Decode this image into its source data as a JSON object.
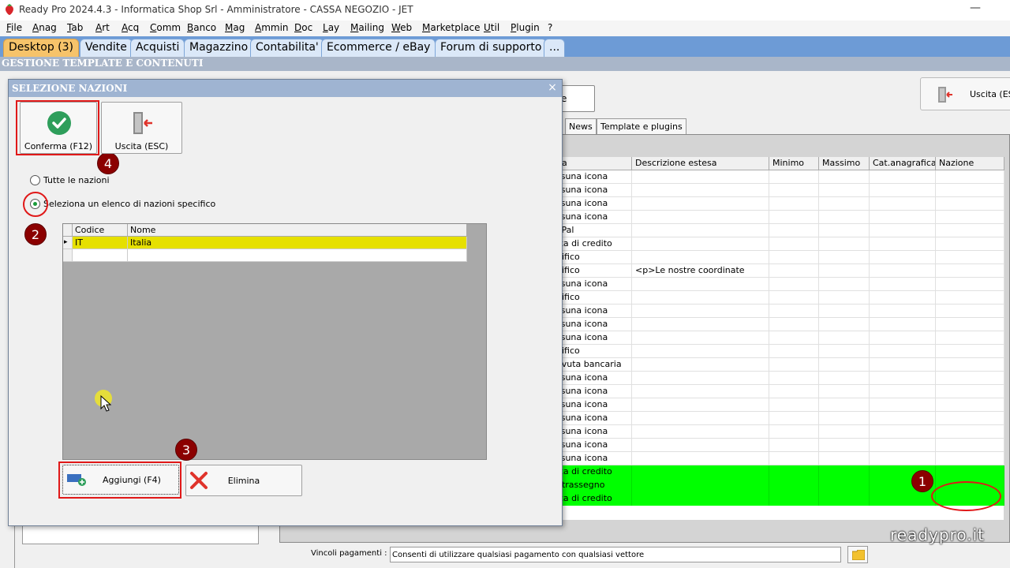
{
  "app": {
    "title": "Ready Pro 2024.4.3 - Informatica Shop Srl - Amministratore - CASSA NEGOZIO - JET",
    "minimize_glyph": "—"
  },
  "menu": [
    "File",
    "Anag",
    "Tab",
    "Art",
    "Acq",
    "Comm",
    "Banco",
    "Mag",
    "Ammin",
    "Doc",
    "Lay",
    "Mailing",
    "Web",
    "Marketplace",
    "Util",
    "Plugin",
    "?"
  ],
  "module_tabs": [
    "Desktop (3)",
    "Vendite",
    "Acquisti",
    "Magazzino",
    "Contabilita'",
    "Ecommerce / eBay",
    "Forum di supporto",
    "..."
  ],
  "section_header": "GESTIONE TEMPLATE E CONTENUTI",
  "background": {
    "exit_button": "Uscita (ESC",
    "partial_button": "e",
    "subtabs": [
      "News",
      "Template e plugins"
    ],
    "grid": {
      "headers": [
        "na",
        "Descrizione estesa",
        "Minimo",
        "Massimo",
        "Cat.anagrafica",
        "Nazione"
      ],
      "rows": [
        {
          "c0": "ssuna icona",
          "c1": "",
          "green": false
        },
        {
          "c0": "ssuna icona",
          "c1": "",
          "green": false
        },
        {
          "c0": "ssuna icona",
          "c1": "",
          "green": false
        },
        {
          "c0": "ssuna icona",
          "c1": "",
          "green": false
        },
        {
          "c0": "yPal",
          "c1": "",
          "green": false
        },
        {
          "c0": "rta di credito",
          "c1": "",
          "green": false
        },
        {
          "c0": "nifico",
          "c1": "",
          "green": false
        },
        {
          "c0": "nifico",
          "c1": "<p>Le nostre coordinate",
          "green": false
        },
        {
          "c0": "ssuna icona",
          "c1": "",
          "green": false
        },
        {
          "c0": "nifico",
          "c1": "",
          "green": false
        },
        {
          "c0": "ssuna icona",
          "c1": "",
          "green": false
        },
        {
          "c0": "ssuna icona",
          "c1": "",
          "green": false
        },
        {
          "c0": "ssuna icona",
          "c1": "",
          "green": false
        },
        {
          "c0": "nifico",
          "c1": "",
          "green": false
        },
        {
          "c0": "evuta bancaria",
          "c1": "",
          "green": false
        },
        {
          "c0": "ssuna icona",
          "c1": "",
          "green": false
        },
        {
          "c0": "ssuna icona",
          "c1": "",
          "green": false
        },
        {
          "c0": "ssuna icona",
          "c1": "",
          "green": false
        },
        {
          "c0": "ssuna icona",
          "c1": "",
          "green": false
        },
        {
          "c0": "ssuna icona",
          "c1": "",
          "green": false
        },
        {
          "c0": "ssuna icona",
          "c1": "",
          "green": false
        },
        {
          "c0": "ssuna icona",
          "c1": "",
          "green": false
        },
        {
          "c0": "rta di credito",
          "c1": "",
          "green": true
        },
        {
          "c0": "ntrassegno",
          "c1": "",
          "green": true
        },
        {
          "c0": "rta di credito",
          "c1": "",
          "green": true
        }
      ]
    },
    "vincoli_label": "Vincoli pagamenti :",
    "vincoli_value": "Consenti di utilizzare qualsiasi pagamento con qualsiasi vettore",
    "watermark": "readypro.it"
  },
  "dialog": {
    "title": "SELEZIONE NAZIONI",
    "close_glyph": "×",
    "confirm_button": "Conferma (F12)",
    "exit_button": "Uscita (ESC)",
    "radio_all": "Tutte le nazioni",
    "radio_specific": "Seleziona un elenco di nazioni specifico",
    "grid": {
      "headers": [
        "Codice",
        "Nome"
      ],
      "rows": [
        {
          "code": "IT",
          "name": "Italia"
        }
      ],
      "row_marker": "▸"
    },
    "add_button": "Aggiungi (F4)",
    "delete_button": "Elimina"
  },
  "annotations": [
    "1",
    "2",
    "3",
    "4"
  ],
  "colors": {
    "accent_red": "#e01818",
    "badge": "#8b0000",
    "highlight_green": "#00ff00",
    "selected_row": "#e6e000",
    "tab_active": "#f6c36a",
    "dialog_title": "#9fb4d2"
  }
}
